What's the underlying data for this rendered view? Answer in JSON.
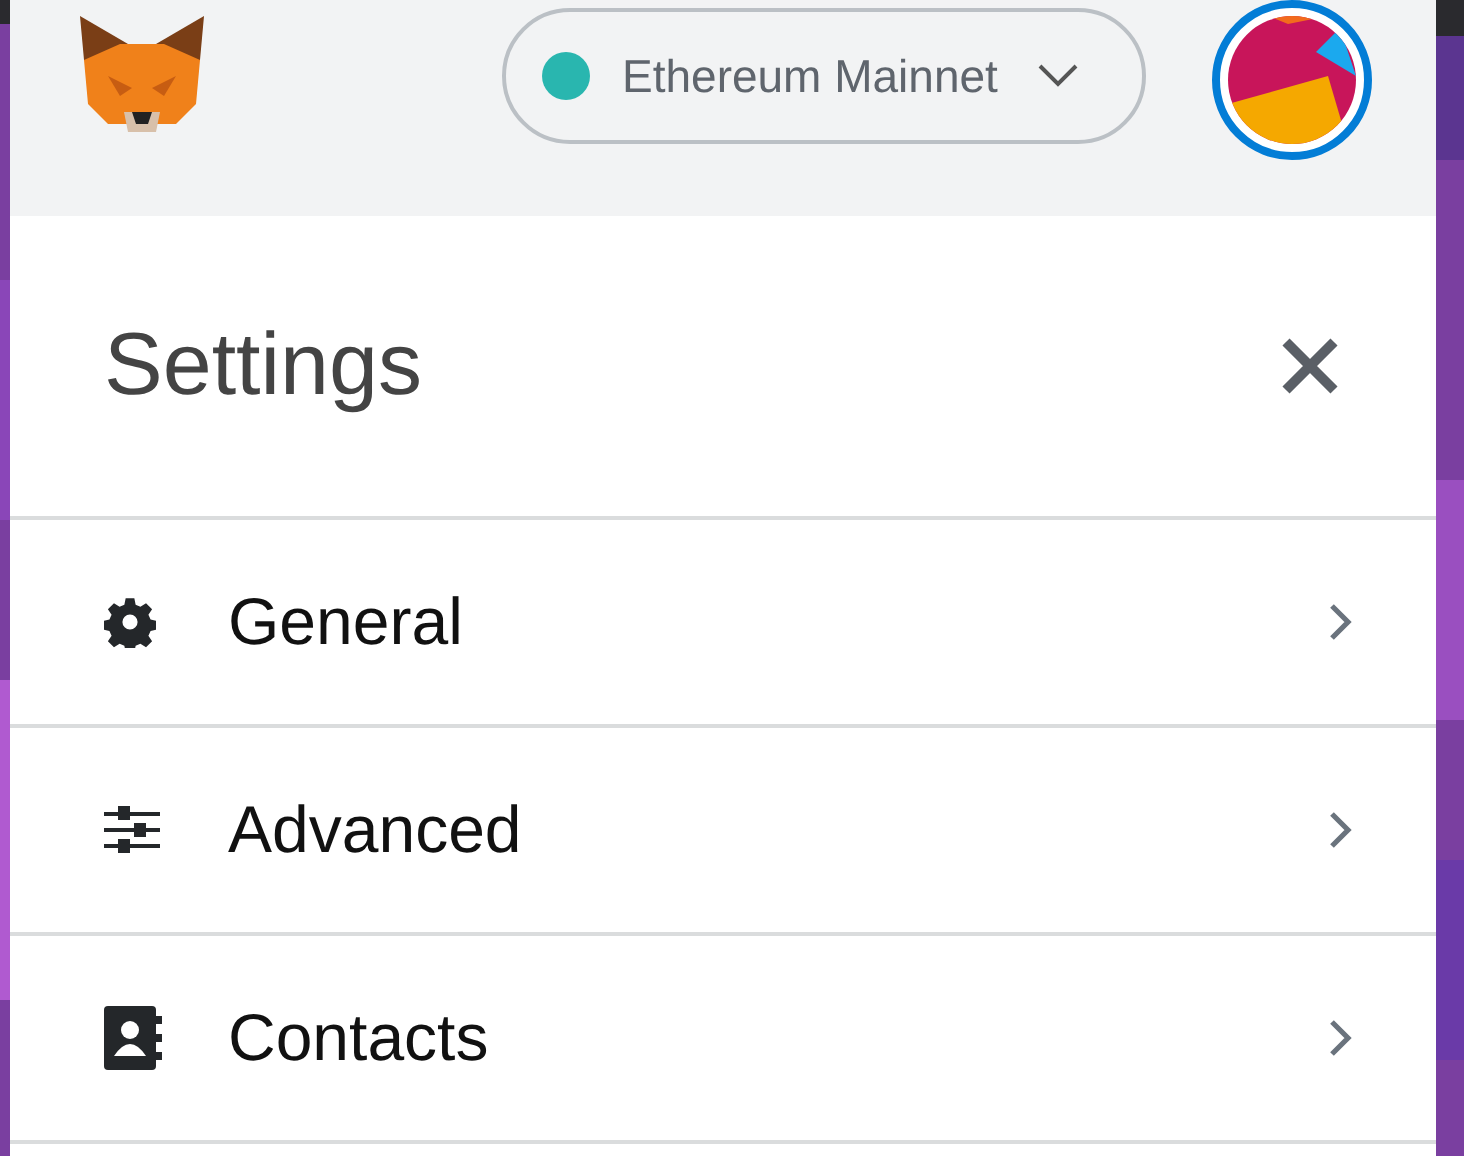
{
  "network": {
    "name": "Ethereum Mainnet"
  },
  "settings": {
    "title": "Settings",
    "items": [
      {
        "label": "General",
        "kind": "gear"
      },
      {
        "label": "Advanced",
        "kind": "sliders"
      },
      {
        "label": "Contacts",
        "kind": "contacts"
      }
    ]
  }
}
